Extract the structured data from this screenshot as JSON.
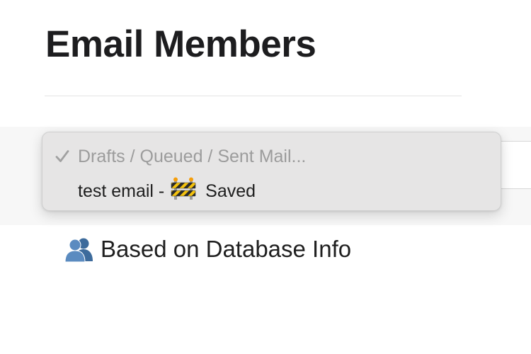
{
  "page": {
    "title": "Email Members"
  },
  "dropdown": {
    "options": [
      {
        "label": "Drafts / Queued / Sent Mail...",
        "selected": true
      },
      {
        "label_prefix": "test email -",
        "icon": "construction-barrier-icon",
        "label_suffix": "Saved",
        "selected": false
      }
    ]
  },
  "filter": {
    "icon": "busts-in-silhouette-icon",
    "label": "Based on Database Info"
  },
  "colors": {
    "menu_background": "#e6e5e5",
    "selected_text": "#9c9c9c",
    "text": "#1e1e1e"
  }
}
